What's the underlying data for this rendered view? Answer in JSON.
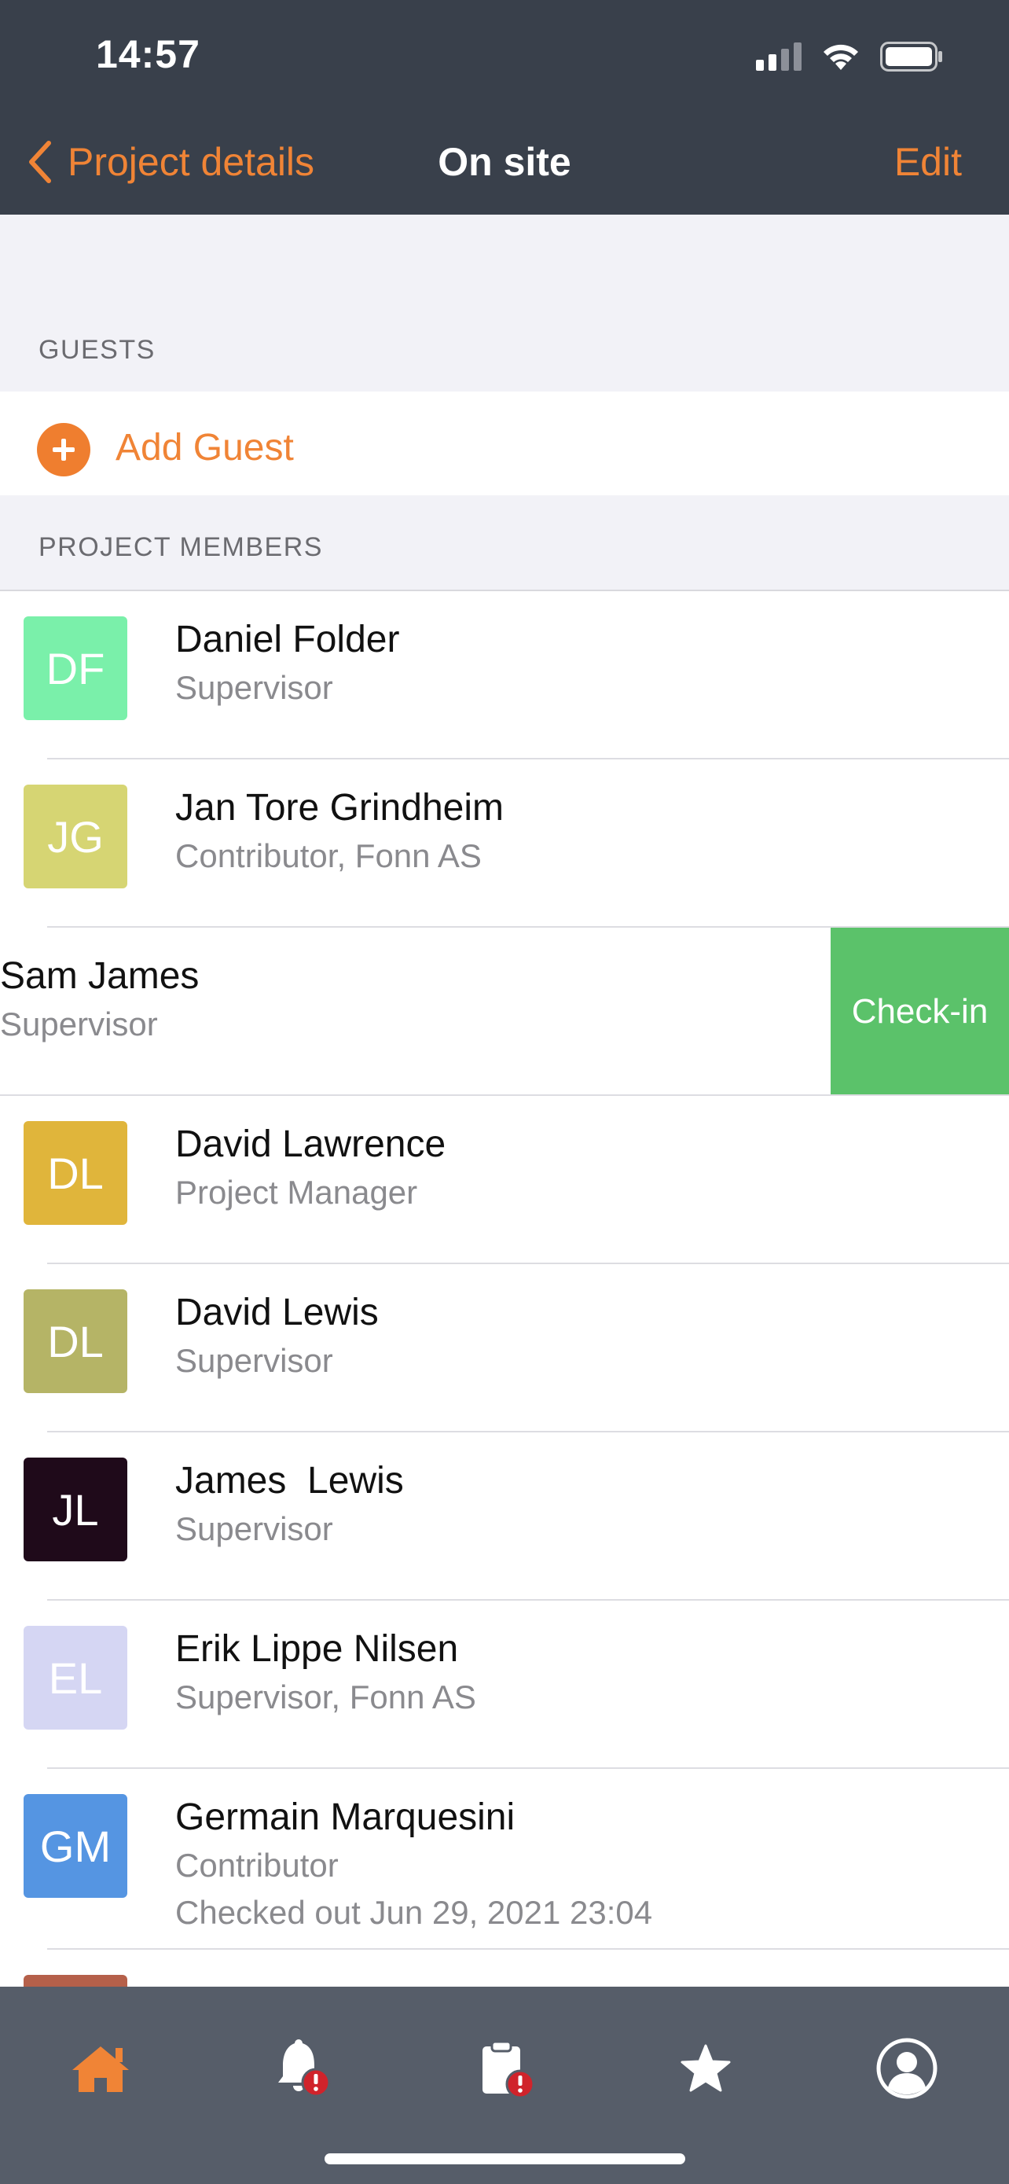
{
  "status_bar": {
    "time": "14:57"
  },
  "nav": {
    "back_label": "Project details",
    "title": "On site",
    "edit_label": "Edit"
  },
  "guests": {
    "header": "GUESTS",
    "add_label": "Add Guest"
  },
  "members": {
    "header": "PROJECT MEMBERS",
    "items": [
      {
        "initials": "DF",
        "name": "Daniel Folder",
        "role": "Supervisor",
        "color": "#7af0aa"
      },
      {
        "initials": "JG",
        "name": "Jan Tore Grindheim",
        "role": "Contributor, Fonn AS",
        "color": "#d6d573"
      },
      {
        "initials": "",
        "name": "Sam James",
        "role": "Supervisor",
        "color": ""
      },
      {
        "initials": "DL",
        "name": "David Lawrence",
        "role": "Project Manager",
        "color": "#e0b53b"
      },
      {
        "initials": "DL",
        "name": "David Lewis",
        "role": "Supervisor",
        "color": "#b5b466"
      },
      {
        "initials": "JL",
        "name": "James  Lewis",
        "role": "Supervisor",
        "color": "#1f0a1a"
      },
      {
        "initials": "EL",
        "name": "Erik Lippe Nilsen",
        "role": "Supervisor, Fonn AS",
        "color": "#d5d6f3"
      },
      {
        "initials": "GM",
        "name": "Germain Marquesini",
        "role": "Contributor",
        "extra": "Checked out Jun 29, 2021 23:04",
        "color": "#5595e2"
      }
    ],
    "swipe_action_label": "Check-in",
    "swipe_action_color": "#5bc26a"
  },
  "tabbar": {
    "tabs": [
      {
        "icon": "home-icon",
        "active": true
      },
      {
        "icon": "bell-icon",
        "badge": "!"
      },
      {
        "icon": "clipboard-icon",
        "badge": "!"
      },
      {
        "icon": "star-icon"
      },
      {
        "icon": "profile-icon"
      }
    ]
  },
  "colors": {
    "accent": "#f08436",
    "navbar": "#39404b",
    "tabbar": "#565d69",
    "badge": "#d0232b"
  }
}
